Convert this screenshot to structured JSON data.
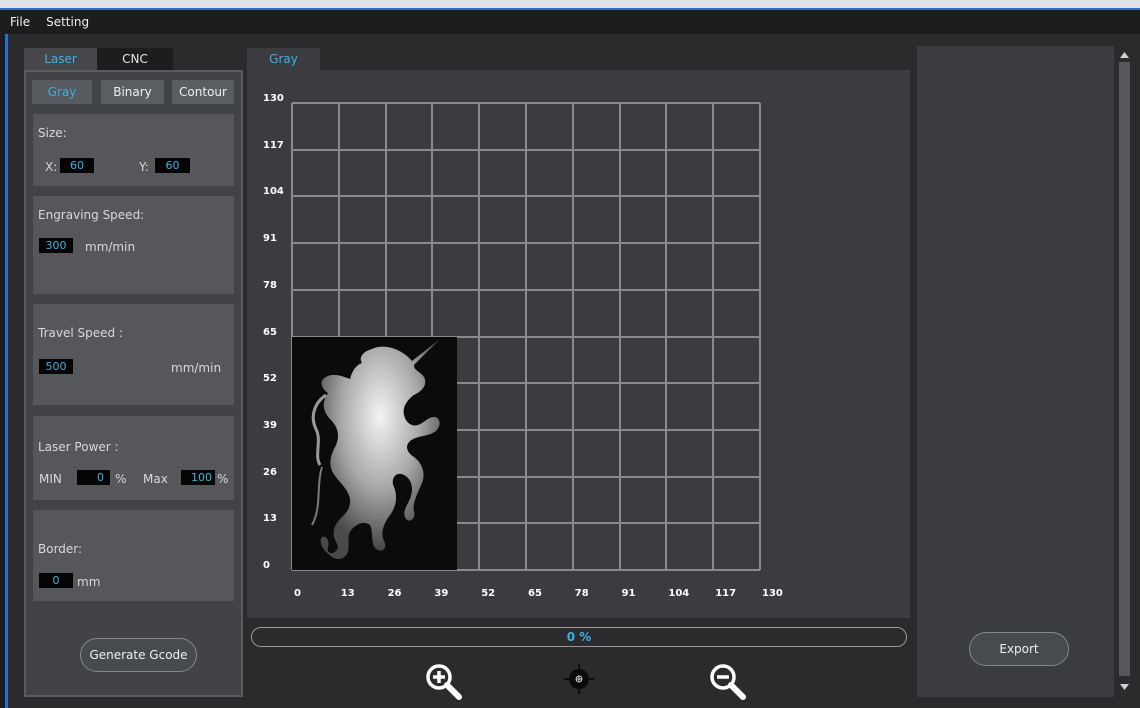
{
  "menu": {
    "file": "File",
    "setting": "Setting"
  },
  "mode_tabs": {
    "laser": "Laser",
    "cnc": "CNC"
  },
  "image_tabs": {
    "gray": "Gray",
    "binary": "Binary",
    "contour": "Contour"
  },
  "size": {
    "label": "Size:",
    "x_label": "X:",
    "x_value": "60",
    "y_label": "Y:",
    "y_value": "60"
  },
  "engraving_speed": {
    "label": "Engraving Speed:",
    "value": "300",
    "unit": "mm/min"
  },
  "travel_speed": {
    "label": "Travel Speed :",
    "value": "500",
    "unit": "mm/min"
  },
  "laser_power": {
    "label": "Laser Power :",
    "min_label": "MIN",
    "min_value": "0",
    "min_unit": "%",
    "max_label": "Max",
    "max_value": "100",
    "max_unit": "%"
  },
  "border": {
    "label": "Border:",
    "value": "0",
    "unit": "mm"
  },
  "generate_button": "Generate Gcode",
  "canvas_tab": "Gray",
  "axis": {
    "y_ticks": [
      "130",
      "117",
      "104",
      "91",
      "78",
      "65",
      "52",
      "39",
      "26",
      "13",
      "0"
    ],
    "x_ticks": [
      "0",
      "13",
      "26",
      "39",
      "52",
      "65",
      "78",
      "91",
      "104",
      "117",
      "130"
    ]
  },
  "progress_text": "0 %",
  "export_button": "Export",
  "icons": {
    "zoom_in": "zoom-in-icon",
    "center": "crosshair-icon",
    "zoom_out": "zoom-out-icon"
  },
  "colors": {
    "accent": "#3fb0e0",
    "panel": "#414346",
    "grid": "#8a8a8c"
  }
}
